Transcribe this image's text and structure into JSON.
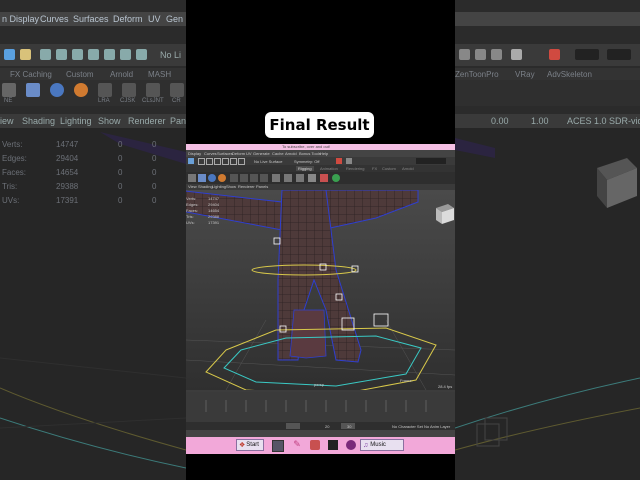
{
  "title": "Final Result",
  "background": {
    "menu_left": [
      "n Display",
      "Curves",
      "Surfaces",
      "Deform",
      "UV",
      "Gen"
    ],
    "shelf_left": [
      "FX Caching",
      "Custom",
      "Arnold",
      "MASH"
    ],
    "shelf_right": [
      "ZenToonPro",
      "VRay",
      "AdvSkeleton"
    ],
    "no_live_label": "No Li",
    "tools_left": [
      "NE",
      "LRA",
      "CJSK",
      "CLsJNT",
      "CR"
    ],
    "panel_menu": [
      "iew",
      "Shading",
      "Lighting",
      "Show",
      "Renderer",
      "Pan"
    ],
    "field_left": "0.00",
    "field_right": "1.00",
    "colorspace": "ACES 1.0 SDR-vide",
    "stats": [
      {
        "label": "Verts:",
        "value": "14747",
        "a": "0",
        "b": "0"
      },
      {
        "label": "Edges:",
        "value": "29404",
        "a": "0",
        "b": "0"
      },
      {
        "label": "Faces:",
        "value": "14654",
        "a": "0",
        "b": "0"
      },
      {
        "label": "Tris:",
        "value": "29388",
        "a": "0",
        "b": "0"
      },
      {
        "label": "UVs:",
        "value": "17391",
        "a": "0",
        "b": "0"
      }
    ]
  },
  "maya": {
    "subscribe_text": "To subscribe, over and out!",
    "menu": [
      "Display",
      "Curves",
      "Surfaces",
      "Deform",
      "UV",
      "Generate",
      "Cache",
      "Arnold",
      "Bonus Tools",
      "Help"
    ],
    "no_live": "No Live Surface",
    "symmetry": "Symmetry: Off",
    "shelf_tabs": [
      "Rigging",
      "Animation",
      "Rendering",
      "FX",
      "Custom",
      "Arnold"
    ],
    "panel_menu": [
      "View",
      "Shading",
      "Lighting",
      "Show",
      "Renderer",
      "Panels"
    ],
    "stats": [
      {
        "label": "Verts:",
        "value": "14747"
      },
      {
        "label": "Edges:",
        "value": "29404"
      },
      {
        "label": "Faces:",
        "value": "14654"
      },
      {
        "label": "Tris:",
        "value": "29388"
      },
      {
        "label": "UVs:",
        "value": "17391"
      }
    ],
    "camera_label": "persp",
    "frame_label": "Frame:",
    "fps": "28.4 fps",
    "range_a": "20",
    "range_b": "30",
    "char_set": "No Character Set",
    "anim_layer": "No Anim Layer"
  },
  "taskbar": {
    "start": "Start",
    "music": "Music"
  },
  "colors": {
    "taskbar_pink": "#f2a8d9",
    "mesh_brown": "#4e3a3a",
    "wire_blue": "#2f3fd0",
    "control_yellow": "#d8c84a",
    "control_cyan": "#3ac9c4"
  }
}
